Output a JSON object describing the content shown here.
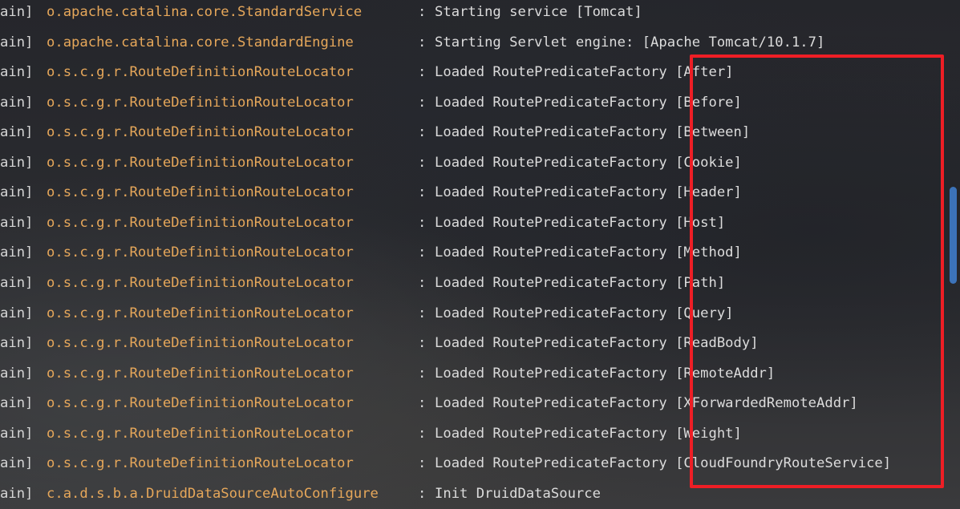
{
  "log_lines": [
    {
      "thread": "ain]",
      "logger": "o.apache.catalina.core.StandardService",
      "sep": ":",
      "message": "Starting service [Tomcat]"
    },
    {
      "thread": "ain]",
      "logger": "o.apache.catalina.core.StandardEngine",
      "sep": ":",
      "message": "Starting Servlet engine: [Apache Tomcat/10.1.7]"
    },
    {
      "thread": "ain]",
      "logger": "o.s.c.g.r.RouteDefinitionRouteLocator",
      "sep": ":",
      "message": "Loaded RoutePredicateFactory [After]"
    },
    {
      "thread": "ain]",
      "logger": "o.s.c.g.r.RouteDefinitionRouteLocator",
      "sep": ":",
      "message": "Loaded RoutePredicateFactory [Before]"
    },
    {
      "thread": "ain]",
      "logger": "o.s.c.g.r.RouteDefinitionRouteLocator",
      "sep": ":",
      "message": "Loaded RoutePredicateFactory [Between]"
    },
    {
      "thread": "ain]",
      "logger": "o.s.c.g.r.RouteDefinitionRouteLocator",
      "sep": ":",
      "message": "Loaded RoutePredicateFactory [Cookie]"
    },
    {
      "thread": "ain]",
      "logger": "o.s.c.g.r.RouteDefinitionRouteLocator",
      "sep": ":",
      "message": "Loaded RoutePredicateFactory [Header]"
    },
    {
      "thread": "ain]",
      "logger": "o.s.c.g.r.RouteDefinitionRouteLocator",
      "sep": ":",
      "message": "Loaded RoutePredicateFactory [Host]"
    },
    {
      "thread": "ain]",
      "logger": "o.s.c.g.r.RouteDefinitionRouteLocator",
      "sep": ":",
      "message": "Loaded RoutePredicateFactory [Method]"
    },
    {
      "thread": "ain]",
      "logger": "o.s.c.g.r.RouteDefinitionRouteLocator",
      "sep": ":",
      "message": "Loaded RoutePredicateFactory [Path]"
    },
    {
      "thread": "ain]",
      "logger": "o.s.c.g.r.RouteDefinitionRouteLocator",
      "sep": ":",
      "message": "Loaded RoutePredicateFactory [Query]"
    },
    {
      "thread": "ain]",
      "logger": "o.s.c.g.r.RouteDefinitionRouteLocator",
      "sep": ":",
      "message": "Loaded RoutePredicateFactory [ReadBody]"
    },
    {
      "thread": "ain]",
      "logger": "o.s.c.g.r.RouteDefinitionRouteLocator",
      "sep": ":",
      "message": "Loaded RoutePredicateFactory [RemoteAddr]"
    },
    {
      "thread": "ain]",
      "logger": "o.s.c.g.r.RouteDefinitionRouteLocator",
      "sep": ":",
      "message": "Loaded RoutePredicateFactory [XForwardedRemoteAddr]"
    },
    {
      "thread": "ain]",
      "logger": "o.s.c.g.r.RouteDefinitionRouteLocator",
      "sep": ":",
      "message": "Loaded RoutePredicateFactory [Weight]"
    },
    {
      "thread": "ain]",
      "logger": "o.s.c.g.r.RouteDefinitionRouteLocator",
      "sep": ":",
      "message": "Loaded RoutePredicateFactory [CloudFoundryRouteService]"
    },
    {
      "thread": "ain]",
      "logger": "c.a.d.s.b.a.DruidDataSourceAutoConfigure",
      "sep": ":",
      "message": "Init DruidDataSource"
    }
  ],
  "colors": {
    "logger": "#e6a75a",
    "text": "#dcdcdc",
    "highlight": "#ee1e25",
    "scrollbar": "#3c73b9",
    "background": "#2a2b2f"
  }
}
